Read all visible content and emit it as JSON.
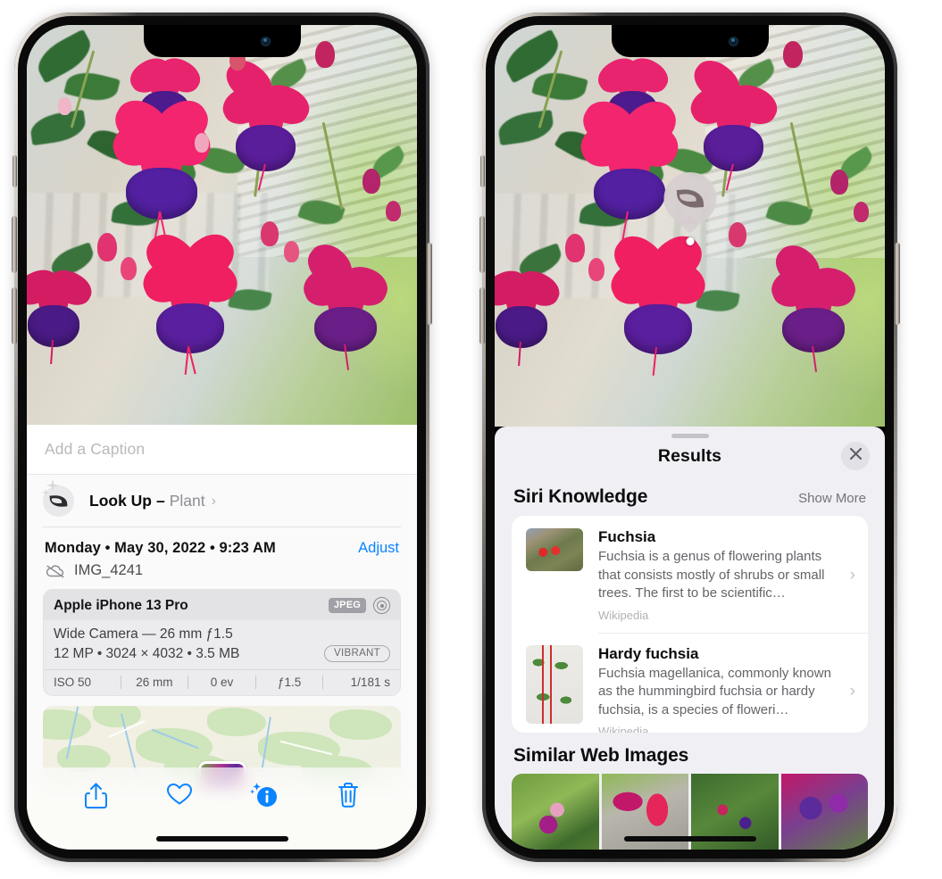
{
  "left_phone": {
    "caption_placeholder": "Add a Caption",
    "lookup": {
      "label": "Look Up",
      "dash": "–",
      "subject": "Plant",
      "chevron": "›",
      "icon": "leaf-sparkle-icon"
    },
    "date": "Monday • May 30, 2022 • 9:23 AM",
    "adjust_label": "Adjust",
    "filename": "IMG_4241",
    "cloud_icon": "cloud-slash-icon",
    "exif": {
      "device": "Apple iPhone 13 Pro",
      "format_badge": "JPEG",
      "raw_icon": "aperture-icon",
      "lens_line": "Wide Camera — 26 mm ƒ1.5",
      "spec_line": "12 MP • 3024 × 4032 • 3.5 MB",
      "style_badge": "VIBRANT",
      "stats": [
        "ISO 50",
        "26 mm",
        "0 ev",
        "ƒ1.5",
        "1/181 s"
      ]
    },
    "toolbar": [
      {
        "name": "share-button",
        "icon": "share-icon"
      },
      {
        "name": "favorite-button",
        "icon": "heart-icon"
      },
      {
        "name": "info-button",
        "icon": "info-sparkle-icon"
      },
      {
        "name": "delete-button",
        "icon": "trash-icon"
      }
    ]
  },
  "right_phone": {
    "visual_lookup_pin": {
      "icon": "leaf-icon"
    },
    "sheet": {
      "title": "Results",
      "close_icon": "close-icon",
      "siri_knowledge": {
        "heading": "Siri Knowledge",
        "show_more": "Show More",
        "items": [
          {
            "title": "Fuchsia",
            "description": "Fuchsia is a genus of flowering plants that consists mostly of shrubs or small trees. The first to be scientific…",
            "source": "Wikipedia",
            "thumb": "fuchsia-red-flowers-thumb",
            "chevron": "›"
          },
          {
            "title": "Hardy fuchsia",
            "description": "Fuchsia magellanica, commonly known as the hummingbird fuchsia or hardy fuchsia, is a species of floweri…",
            "source": "Wikipedia",
            "thumb": "hardy-fuchsia-specimen-thumb",
            "chevron": "›"
          }
        ]
      },
      "similar_web_images": {
        "heading": "Similar Web Images",
        "images": [
          "fuchsia-pink-purple-leaves",
          "fuchsia-red-closeup",
          "fuchsia-bush-buds",
          "fuchsia-purple-cluster"
        ]
      }
    }
  },
  "colors": {
    "accent_blue": "#0a84ff",
    "sheet_bg": "#f0eff4",
    "card_bg": "#ffffff",
    "secondary_text": "#8e8e93",
    "badge_gray": "#a0a0a6"
  }
}
